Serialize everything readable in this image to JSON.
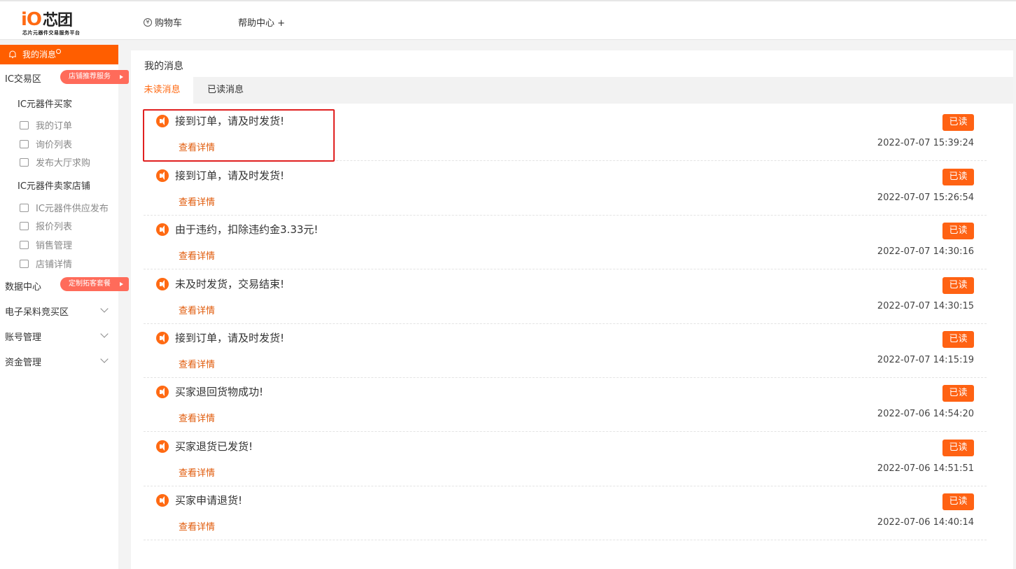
{
  "logo": {
    "brand_latin": "iO",
    "brand_cn": "芯团",
    "tagline": "芯片元器件交易服务平台"
  },
  "nav": {
    "cart_label": "购物车",
    "help_label": "帮助中心 +"
  },
  "sidebar": {
    "active_item": "我的消息",
    "ic_trade": "IC交易区",
    "ic_trade_badge": "店铺推荐服务",
    "buyer_title": "IC元器件买家",
    "buyer_items": [
      "我的订单",
      "询价列表",
      "发布大厅求购"
    ],
    "seller_title": "IC元器件卖家店铺",
    "seller_items": [
      "IC元器件供应发布",
      "报价列表",
      "销售管理",
      "店铺详情"
    ],
    "data_center": "数据中心",
    "data_center_badge": "定制拓客套餐",
    "collapsible": [
      "电子呆料竞买区",
      "账号管理",
      "资金管理"
    ]
  },
  "main": {
    "title": "我的消息",
    "tabs": [
      "未读消息",
      "已读消息"
    ],
    "read_button": "已读",
    "detail_link": "查看详情",
    "messages": [
      {
        "title": "接到订单，请及时发货!",
        "time": "2022-07-07 15:39:24"
      },
      {
        "title": "接到订单，请及时发货!",
        "time": "2022-07-07 15:26:54"
      },
      {
        "title": "由于违约，扣除违约金3.33元!",
        "time": "2022-07-07 14:30:16"
      },
      {
        "title": "未及时发货，交易结束!",
        "time": "2022-07-07 14:30:15"
      },
      {
        "title": "接到订单，请及时发货!",
        "time": "2022-07-07 14:15:19"
      },
      {
        "title": "买家退回货物成功!",
        "time": "2022-07-06 14:54:20"
      },
      {
        "title": "买家退货已发货!",
        "time": "2022-07-06 14:51:51"
      },
      {
        "title": "买家申请退货!",
        "time": "2022-07-06 14:40:14"
      }
    ]
  },
  "colors": {
    "accent": "#ff6213",
    "highlight_border": "#e02020"
  }
}
